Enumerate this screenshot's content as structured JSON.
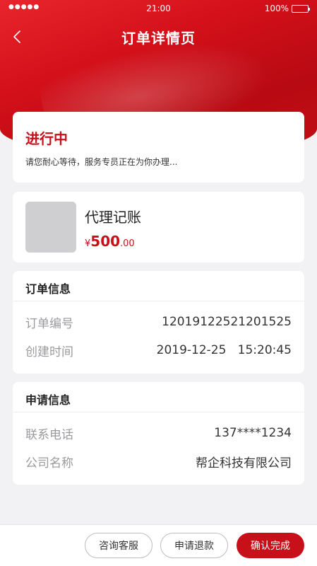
{
  "status_bar": {
    "signal": "●●●●●",
    "time": "21:00",
    "battery": "100%"
  },
  "nav": {
    "back_icon": "chevron-left-icon",
    "title": "订单详情页"
  },
  "status": {
    "title": "进行中",
    "description": "请您耐心等待，服务专员正在为你办理..."
  },
  "product": {
    "name": "代理记账",
    "currency": "¥",
    "price_int": "500",
    "price_dec": ".00"
  },
  "order_info": {
    "title": "订单信息",
    "rows": [
      {
        "label": "订单编号",
        "value": "12019122521201525"
      },
      {
        "label": "创建时间",
        "value": "2019-12-25   15:20:45"
      }
    ]
  },
  "apply_info": {
    "title": "申请信息",
    "rows": [
      {
        "label": "联系电话",
        "value": "137****1234"
      },
      {
        "label": "公司名称",
        "value": "帮企科技有限公司"
      }
    ]
  },
  "actions": {
    "consult": "咨询客服",
    "refund": "申请退款",
    "confirm": "确认完成"
  },
  "colors": {
    "brand": "#c8101a",
    "background": "#f2f2f4"
  }
}
